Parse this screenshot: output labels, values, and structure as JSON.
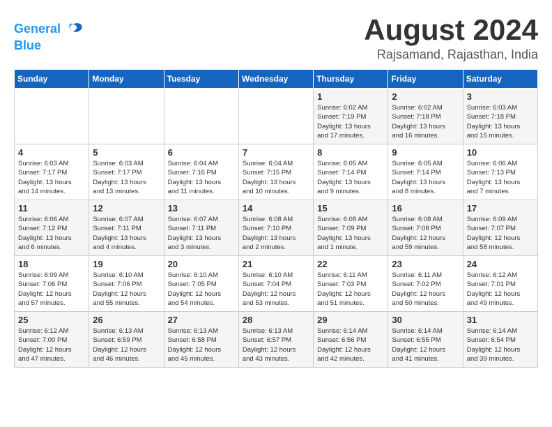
{
  "header": {
    "logo_line1": "General",
    "logo_line2": "Blue",
    "month_title": "August 2024",
    "location": "Rajsamand, Rajasthan, India"
  },
  "days_of_week": [
    "Sunday",
    "Monday",
    "Tuesday",
    "Wednesday",
    "Thursday",
    "Friday",
    "Saturday"
  ],
  "weeks": [
    [
      {
        "day": "",
        "info": ""
      },
      {
        "day": "",
        "info": ""
      },
      {
        "day": "",
        "info": ""
      },
      {
        "day": "",
        "info": ""
      },
      {
        "day": "1",
        "info": "Sunrise: 6:02 AM\nSunset: 7:19 PM\nDaylight: 13 hours\nand 17 minutes."
      },
      {
        "day": "2",
        "info": "Sunrise: 6:02 AM\nSunset: 7:18 PM\nDaylight: 13 hours\nand 16 minutes."
      },
      {
        "day": "3",
        "info": "Sunrise: 6:03 AM\nSunset: 7:18 PM\nDaylight: 13 hours\nand 15 minutes."
      }
    ],
    [
      {
        "day": "4",
        "info": "Sunrise: 6:03 AM\nSunset: 7:17 PM\nDaylight: 13 hours\nand 14 minutes."
      },
      {
        "day": "5",
        "info": "Sunrise: 6:03 AM\nSunset: 7:17 PM\nDaylight: 13 hours\nand 13 minutes."
      },
      {
        "day": "6",
        "info": "Sunrise: 6:04 AM\nSunset: 7:16 PM\nDaylight: 13 hours\nand 11 minutes."
      },
      {
        "day": "7",
        "info": "Sunrise: 6:04 AM\nSunset: 7:15 PM\nDaylight: 13 hours\nand 10 minutes."
      },
      {
        "day": "8",
        "info": "Sunrise: 6:05 AM\nSunset: 7:14 PM\nDaylight: 13 hours\nand 9 minutes."
      },
      {
        "day": "9",
        "info": "Sunrise: 6:05 AM\nSunset: 7:14 PM\nDaylight: 13 hours\nand 8 minutes."
      },
      {
        "day": "10",
        "info": "Sunrise: 6:06 AM\nSunset: 7:13 PM\nDaylight: 13 hours\nand 7 minutes."
      }
    ],
    [
      {
        "day": "11",
        "info": "Sunrise: 6:06 AM\nSunset: 7:12 PM\nDaylight: 13 hours\nand 6 minutes."
      },
      {
        "day": "12",
        "info": "Sunrise: 6:07 AM\nSunset: 7:11 PM\nDaylight: 13 hours\nand 4 minutes."
      },
      {
        "day": "13",
        "info": "Sunrise: 6:07 AM\nSunset: 7:11 PM\nDaylight: 13 hours\nand 3 minutes."
      },
      {
        "day": "14",
        "info": "Sunrise: 6:08 AM\nSunset: 7:10 PM\nDaylight: 13 hours\nand 2 minutes."
      },
      {
        "day": "15",
        "info": "Sunrise: 6:08 AM\nSunset: 7:09 PM\nDaylight: 13 hours\nand 1 minute."
      },
      {
        "day": "16",
        "info": "Sunrise: 6:08 AM\nSunset: 7:08 PM\nDaylight: 12 hours\nand 59 minutes."
      },
      {
        "day": "17",
        "info": "Sunrise: 6:09 AM\nSunset: 7:07 PM\nDaylight: 12 hours\nand 58 minutes."
      }
    ],
    [
      {
        "day": "18",
        "info": "Sunrise: 6:09 AM\nSunset: 7:06 PM\nDaylight: 12 hours\nand 57 minutes."
      },
      {
        "day": "19",
        "info": "Sunrise: 6:10 AM\nSunset: 7:06 PM\nDaylight: 12 hours\nand 55 minutes."
      },
      {
        "day": "20",
        "info": "Sunrise: 6:10 AM\nSunset: 7:05 PM\nDaylight: 12 hours\nand 54 minutes."
      },
      {
        "day": "21",
        "info": "Sunrise: 6:10 AM\nSunset: 7:04 PM\nDaylight: 12 hours\nand 53 minutes."
      },
      {
        "day": "22",
        "info": "Sunrise: 6:11 AM\nSunset: 7:03 PM\nDaylight: 12 hours\nand 51 minutes."
      },
      {
        "day": "23",
        "info": "Sunrise: 6:11 AM\nSunset: 7:02 PM\nDaylight: 12 hours\nand 50 minutes."
      },
      {
        "day": "24",
        "info": "Sunrise: 6:12 AM\nSunset: 7:01 PM\nDaylight: 12 hours\nand 49 minutes."
      }
    ],
    [
      {
        "day": "25",
        "info": "Sunrise: 6:12 AM\nSunset: 7:00 PM\nDaylight: 12 hours\nand 47 minutes."
      },
      {
        "day": "26",
        "info": "Sunrise: 6:13 AM\nSunset: 6:59 PM\nDaylight: 12 hours\nand 46 minutes."
      },
      {
        "day": "27",
        "info": "Sunrise: 6:13 AM\nSunset: 6:58 PM\nDaylight: 12 hours\nand 45 minutes."
      },
      {
        "day": "28",
        "info": "Sunrise: 6:13 AM\nSunset: 6:57 PM\nDaylight: 12 hours\nand 43 minutes."
      },
      {
        "day": "29",
        "info": "Sunrise: 6:14 AM\nSunset: 6:56 PM\nDaylight: 12 hours\nand 42 minutes."
      },
      {
        "day": "30",
        "info": "Sunrise: 6:14 AM\nSunset: 6:55 PM\nDaylight: 12 hours\nand 41 minutes."
      },
      {
        "day": "31",
        "info": "Sunrise: 6:14 AM\nSunset: 6:54 PM\nDaylight: 12 hours\nand 39 minutes."
      }
    ]
  ]
}
